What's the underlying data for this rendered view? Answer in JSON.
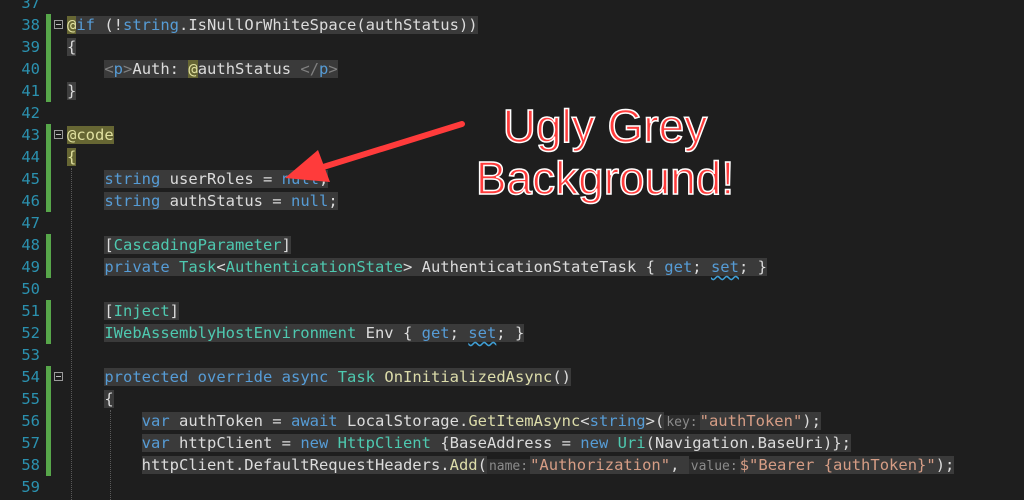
{
  "lines": [
    {
      "num": "37",
      "tokens": []
    },
    {
      "num": "38",
      "tokens": [
        {
          "t": "@",
          "c": "at"
        },
        {
          "t": "if",
          "c": "kw hl"
        },
        {
          "t": " (!",
          "c": "hl"
        },
        {
          "t": "string",
          "c": "kw hl"
        },
        {
          "t": ".IsNullOrWhiteSpace(authStatus))",
          "c": "hl"
        }
      ]
    },
    {
      "num": "39",
      "tokens": [
        {
          "t": "{",
          "c": "bk"
        }
      ]
    },
    {
      "num": "40",
      "tokens": [
        {
          "t": "    "
        },
        {
          "t": "<",
          "c": "tag hl"
        },
        {
          "t": "p",
          "c": "tn hl"
        },
        {
          "t": ">",
          "c": "tag hl"
        },
        {
          "t": "Auth: ",
          "c": "hl"
        },
        {
          "t": "@",
          "c": "at"
        },
        {
          "t": "authStatus ",
          "c": "hl"
        },
        {
          "t": "</",
          "c": "tag hl"
        },
        {
          "t": "p",
          "c": "tn hl"
        },
        {
          "t": ">",
          "c": "tag hl"
        }
      ]
    },
    {
      "num": "41",
      "tokens": [
        {
          "t": "}",
          "c": "bk"
        }
      ]
    },
    {
      "num": "42",
      "tokens": []
    },
    {
      "num": "43",
      "tokens": [
        {
          "t": "@code",
          "c": "at"
        }
      ]
    },
    {
      "num": "44",
      "tokens": [
        {
          "t": "{",
          "c": "at"
        }
      ]
    },
    {
      "num": "45",
      "tokens": [
        {
          "t": "    "
        },
        {
          "t": "string",
          "c": "kw hl"
        },
        {
          "t": " userRoles = ",
          "c": "hl"
        },
        {
          "t": "null",
          "c": "kw hl"
        },
        {
          "t": ";",
          "c": "hl"
        }
      ]
    },
    {
      "num": "46",
      "tokens": [
        {
          "t": "    "
        },
        {
          "t": "string",
          "c": "kw hl"
        },
        {
          "t": " authStatus = ",
          "c": "hl"
        },
        {
          "t": "null",
          "c": "kw hl"
        },
        {
          "t": ";",
          "c": "hl"
        }
      ]
    },
    {
      "num": "47",
      "tokens": []
    },
    {
      "num": "48",
      "tokens": [
        {
          "t": "    "
        },
        {
          "t": "[",
          "c": "hl"
        },
        {
          "t": "CascadingParameter",
          "c": "ty hl"
        },
        {
          "t": "]",
          "c": "hl"
        }
      ]
    },
    {
      "num": "49",
      "tokens": [
        {
          "t": "    "
        },
        {
          "t": "private",
          "c": "kw hl"
        },
        {
          "t": " ",
          "c": "hl"
        },
        {
          "t": "Task",
          "c": "ty hl"
        },
        {
          "t": "<",
          "c": "hl"
        },
        {
          "t": "AuthenticationState",
          "c": "ty hl"
        },
        {
          "t": "> AuthenticationStateTask { ",
          "c": "hl"
        },
        {
          "t": "get",
          "c": "kw hl"
        },
        {
          "t": "; ",
          "c": "hl"
        },
        {
          "t": "set",
          "c": "kw hl sq"
        },
        {
          "t": "; }",
          "c": "hl"
        }
      ]
    },
    {
      "num": "50",
      "tokens": []
    },
    {
      "num": "51",
      "tokens": [
        {
          "t": "    "
        },
        {
          "t": "[",
          "c": "hl"
        },
        {
          "t": "Inject",
          "c": "ty hl"
        },
        {
          "t": "]",
          "c": "hl"
        }
      ]
    },
    {
      "num": "52",
      "tokens": [
        {
          "t": "    "
        },
        {
          "t": "IWebAssemblyHostEnvironment",
          "c": "ty hl"
        },
        {
          "t": " Env { ",
          "c": "hl"
        },
        {
          "t": "get",
          "c": "kw hl"
        },
        {
          "t": "; ",
          "c": "hl"
        },
        {
          "t": "set",
          "c": "kw hl sq"
        },
        {
          "t": "; }",
          "c": "hl"
        }
      ]
    },
    {
      "num": "53",
      "tokens": []
    },
    {
      "num": "54",
      "tokens": [
        {
          "t": "    "
        },
        {
          "t": "protected",
          "c": "kw hl"
        },
        {
          "t": " ",
          "c": "hl"
        },
        {
          "t": "override",
          "c": "kw hl"
        },
        {
          "t": " ",
          "c": "hl"
        },
        {
          "t": "async",
          "c": "kw hl"
        },
        {
          "t": " ",
          "c": "hl"
        },
        {
          "t": "Task",
          "c": "ty hl"
        },
        {
          "t": " ",
          "c": "hl"
        },
        {
          "t": "OnInitializedAsync",
          "c": "mth hl"
        },
        {
          "t": "()",
          "c": "hl"
        }
      ]
    },
    {
      "num": "55",
      "tokens": [
        {
          "t": "    "
        },
        {
          "t": "{",
          "c": "hl"
        }
      ]
    },
    {
      "num": "56",
      "tokens": [
        {
          "t": "        "
        },
        {
          "t": "var",
          "c": "kw hl"
        },
        {
          "t": " authToken = ",
          "c": "hl"
        },
        {
          "t": "await",
          "c": "kw hl"
        },
        {
          "t": " LocalStorage.",
          "c": "hl"
        },
        {
          "t": "GetItemAsync",
          "c": "mth hl"
        },
        {
          "t": "<",
          "c": "hl"
        },
        {
          "t": "string",
          "c": "kw hl"
        },
        {
          "t": ">(",
          "c": "hl"
        },
        {
          "t": "key:",
          "c": "hint"
        },
        {
          "t": "\"authToken\"",
          "c": "st hl"
        },
        {
          "t": ");",
          "c": "hl"
        }
      ]
    },
    {
      "num": "57",
      "tokens": [
        {
          "t": "        "
        },
        {
          "t": "var",
          "c": "kw hl"
        },
        {
          "t": " httpClient = ",
          "c": "hl"
        },
        {
          "t": "new",
          "c": "kw hl"
        },
        {
          "t": " ",
          "c": "hl"
        },
        {
          "t": "HttpClient",
          "c": "ty hl"
        },
        {
          "t": " {BaseAddress = ",
          "c": "hl"
        },
        {
          "t": "new",
          "c": "kw hl"
        },
        {
          "t": " ",
          "c": "hl"
        },
        {
          "t": "Uri",
          "c": "ty hl"
        },
        {
          "t": "(Navigation.BaseUri)};",
          "c": "hl"
        }
      ]
    },
    {
      "num": "58",
      "tokens": [
        {
          "t": "        "
        },
        {
          "t": "httpClient.DefaultRequestHeaders.",
          "c": "hl"
        },
        {
          "t": "Add",
          "c": "mth hl"
        },
        {
          "t": "(",
          "c": "hl"
        },
        {
          "t": "name:",
          "c": "hint"
        },
        {
          "t": "\"Authorization\"",
          "c": "st hl"
        },
        {
          "t": ", ",
          "c": "hl"
        },
        {
          "t": "value:",
          "c": "hint"
        },
        {
          "t": "$\"Bearer {authToken}\"",
          "c": "st hl"
        },
        {
          "t": ");",
          "c": "hl"
        }
      ]
    },
    {
      "num": "59",
      "tokens": []
    }
  ],
  "annotation": {
    "line1": "Ugly Grey",
    "line2": "Background!"
  },
  "colors": {
    "annotation_text": "#ff3b3b",
    "arrow": "#ff3b3b",
    "changed_lines_bar": "#57a64a"
  }
}
